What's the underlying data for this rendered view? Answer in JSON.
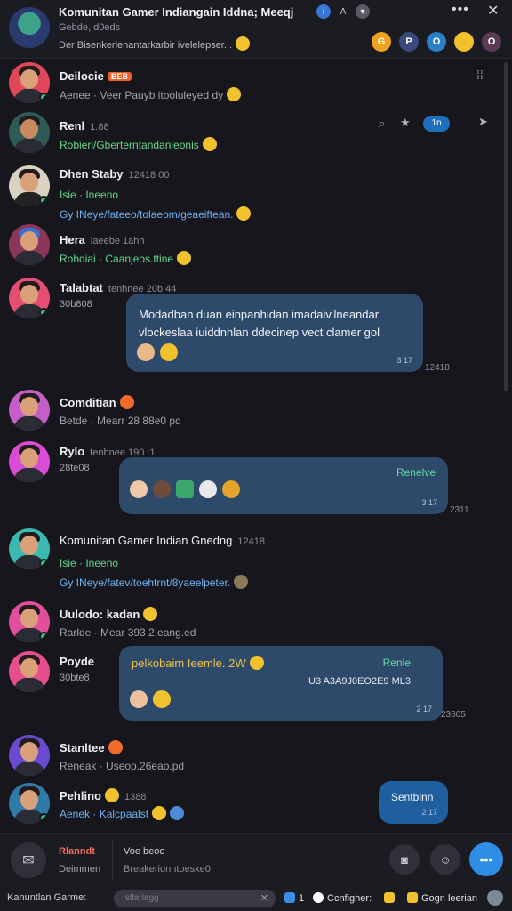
{
  "header": {
    "title": "Komunitan Gamer Indiangain Iddna; Meeqj",
    "sub1": "Gebde, d0eds",
    "sub2": "Der Bisenkerlenantarkarbir ivelelepser...",
    "more": "•••",
    "close": "✕",
    "actions": [
      "G",
      "P",
      "O",
      "",
      "O"
    ]
  },
  "messages": [
    {
      "name": "Deilocie",
      "tag": "BEB",
      "line1": "Aenee · Veer Pauyb itooluleyed dy"
    },
    {
      "name": "Renl",
      "time": "1.88",
      "line1": "Robierl/Gberterntandanieonis",
      "badge": "1n"
    },
    {
      "name": "Dhen Staby",
      "time": "12418 00",
      "line1": "Isie · Ineeno",
      "line2": "Gy  INeye/fateeo/tolaeom/geaeiftean."
    },
    {
      "name": "Hera",
      "time": "laeebe 1ahh",
      "line1": "Rohdiai · Caanjeos.ttine"
    },
    {
      "name": "Talabtat",
      "time": "tenhnee 20b 44",
      "line1": "30b808",
      "bubble": "Modadban duan einpanhidan imadaiv.lneandar\nvlockeslaa iuiddnhlan ddecinep vect clamer gol",
      "bubble_time": "3 17",
      "out_time": "12418"
    },
    {
      "name": "Comditian",
      "line1": "Betde · Mearr 28 88e0 pd"
    },
    {
      "name": "Rylo",
      "time": "tenhnee 190 :1",
      "line1": "28te08",
      "reply": "Renelve",
      "bubble_time": "3 17",
      "out_time": "2311"
    },
    {
      "name": "Komunitan Gamer Indian Gnedng",
      "time": "12418",
      "line1": "Isie · Ineeno",
      "line2": "Gy  INeye/fatev/toehtrnt/8yaeelpeter."
    },
    {
      "name": "Uulodo: kadan",
      "line1": "Rarlde · Mear 393 2.eang.ed"
    },
    {
      "name": "Poyde",
      "line1": "30bte8",
      "bubble": "pelkobaim Ieemle. 2W",
      "reply": "Renle",
      "bubble2": "U3 A3A9J0EO2E9 ML3",
      "bubble_time": "2 17",
      "out_time": "23605"
    },
    {
      "name": "Stanltee",
      "line1": "Reneak · Useop.26eao.pd"
    },
    {
      "name": "Pehlino",
      "time": "1388",
      "line1": "Aenek · Kalcpaalst",
      "bubble": "Sentbinn",
      "bubble_time": "2 17"
    }
  ],
  "composer": {
    "label": "Rlanndt",
    "label2": "Deimmen",
    "value": "Voe beoo",
    "placeholder": "Breakerionntoesxe0"
  },
  "statusbar": {
    "left": "Kanuntlan Garme:",
    "search_placeholder": "Istlarlagg",
    "search_clear": "✕",
    "count": "1",
    "item1": "Ccnfigher:",
    "item2": "Gogn leerian"
  },
  "colors": {
    "accent": "#2f8de6",
    "bubble": "#2e4a6b",
    "green": "#63d88a",
    "red_label": "#f26b5b"
  }
}
